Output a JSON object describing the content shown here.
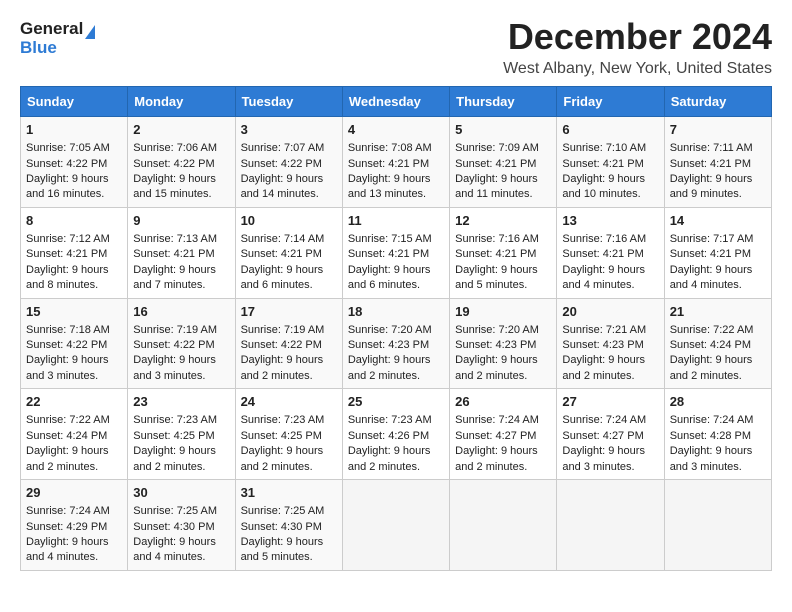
{
  "app": {
    "logo_line1": "General",
    "logo_line2": "Blue"
  },
  "title": "December 2024",
  "subtitle": "West Albany, New York, United States",
  "days_header": [
    "Sunday",
    "Monday",
    "Tuesday",
    "Wednesday",
    "Thursday",
    "Friday",
    "Saturday"
  ],
  "weeks": [
    [
      {
        "day": "1",
        "info": "Sunrise: 7:05 AM\nSunset: 4:22 PM\nDaylight: 9 hours\nand 16 minutes."
      },
      {
        "day": "2",
        "info": "Sunrise: 7:06 AM\nSunset: 4:22 PM\nDaylight: 9 hours\nand 15 minutes."
      },
      {
        "day": "3",
        "info": "Sunrise: 7:07 AM\nSunset: 4:22 PM\nDaylight: 9 hours\nand 14 minutes."
      },
      {
        "day": "4",
        "info": "Sunrise: 7:08 AM\nSunset: 4:21 PM\nDaylight: 9 hours\nand 13 minutes."
      },
      {
        "day": "5",
        "info": "Sunrise: 7:09 AM\nSunset: 4:21 PM\nDaylight: 9 hours\nand 11 minutes."
      },
      {
        "day": "6",
        "info": "Sunrise: 7:10 AM\nSunset: 4:21 PM\nDaylight: 9 hours\nand 10 minutes."
      },
      {
        "day": "7",
        "info": "Sunrise: 7:11 AM\nSunset: 4:21 PM\nDaylight: 9 hours\nand 9 minutes."
      }
    ],
    [
      {
        "day": "8",
        "info": "Sunrise: 7:12 AM\nSunset: 4:21 PM\nDaylight: 9 hours\nand 8 minutes."
      },
      {
        "day": "9",
        "info": "Sunrise: 7:13 AM\nSunset: 4:21 PM\nDaylight: 9 hours\nand 7 minutes."
      },
      {
        "day": "10",
        "info": "Sunrise: 7:14 AM\nSunset: 4:21 PM\nDaylight: 9 hours\nand 6 minutes."
      },
      {
        "day": "11",
        "info": "Sunrise: 7:15 AM\nSunset: 4:21 PM\nDaylight: 9 hours\nand 6 minutes."
      },
      {
        "day": "12",
        "info": "Sunrise: 7:16 AM\nSunset: 4:21 PM\nDaylight: 9 hours\nand 5 minutes."
      },
      {
        "day": "13",
        "info": "Sunrise: 7:16 AM\nSunset: 4:21 PM\nDaylight: 9 hours\nand 4 minutes."
      },
      {
        "day": "14",
        "info": "Sunrise: 7:17 AM\nSunset: 4:21 PM\nDaylight: 9 hours\nand 4 minutes."
      }
    ],
    [
      {
        "day": "15",
        "info": "Sunrise: 7:18 AM\nSunset: 4:22 PM\nDaylight: 9 hours\nand 3 minutes."
      },
      {
        "day": "16",
        "info": "Sunrise: 7:19 AM\nSunset: 4:22 PM\nDaylight: 9 hours\nand 3 minutes."
      },
      {
        "day": "17",
        "info": "Sunrise: 7:19 AM\nSunset: 4:22 PM\nDaylight: 9 hours\nand 2 minutes."
      },
      {
        "day": "18",
        "info": "Sunrise: 7:20 AM\nSunset: 4:23 PM\nDaylight: 9 hours\nand 2 minutes."
      },
      {
        "day": "19",
        "info": "Sunrise: 7:20 AM\nSunset: 4:23 PM\nDaylight: 9 hours\nand 2 minutes."
      },
      {
        "day": "20",
        "info": "Sunrise: 7:21 AM\nSunset: 4:23 PM\nDaylight: 9 hours\nand 2 minutes."
      },
      {
        "day": "21",
        "info": "Sunrise: 7:22 AM\nSunset: 4:24 PM\nDaylight: 9 hours\nand 2 minutes."
      }
    ],
    [
      {
        "day": "22",
        "info": "Sunrise: 7:22 AM\nSunset: 4:24 PM\nDaylight: 9 hours\nand 2 minutes."
      },
      {
        "day": "23",
        "info": "Sunrise: 7:23 AM\nSunset: 4:25 PM\nDaylight: 9 hours\nand 2 minutes."
      },
      {
        "day": "24",
        "info": "Sunrise: 7:23 AM\nSunset: 4:25 PM\nDaylight: 9 hours\nand 2 minutes."
      },
      {
        "day": "25",
        "info": "Sunrise: 7:23 AM\nSunset: 4:26 PM\nDaylight: 9 hours\nand 2 minutes."
      },
      {
        "day": "26",
        "info": "Sunrise: 7:24 AM\nSunset: 4:27 PM\nDaylight: 9 hours\nand 2 minutes."
      },
      {
        "day": "27",
        "info": "Sunrise: 7:24 AM\nSunset: 4:27 PM\nDaylight: 9 hours\nand 3 minutes."
      },
      {
        "day": "28",
        "info": "Sunrise: 7:24 AM\nSunset: 4:28 PM\nDaylight: 9 hours\nand 3 minutes."
      }
    ],
    [
      {
        "day": "29",
        "info": "Sunrise: 7:24 AM\nSunset: 4:29 PM\nDaylight: 9 hours\nand 4 minutes."
      },
      {
        "day": "30",
        "info": "Sunrise: 7:25 AM\nSunset: 4:30 PM\nDaylight: 9 hours\nand 4 minutes."
      },
      {
        "day": "31",
        "info": "Sunrise: 7:25 AM\nSunset: 4:30 PM\nDaylight: 9 hours\nand 5 minutes."
      },
      {
        "day": "",
        "info": ""
      },
      {
        "day": "",
        "info": ""
      },
      {
        "day": "",
        "info": ""
      },
      {
        "day": "",
        "info": ""
      }
    ]
  ]
}
